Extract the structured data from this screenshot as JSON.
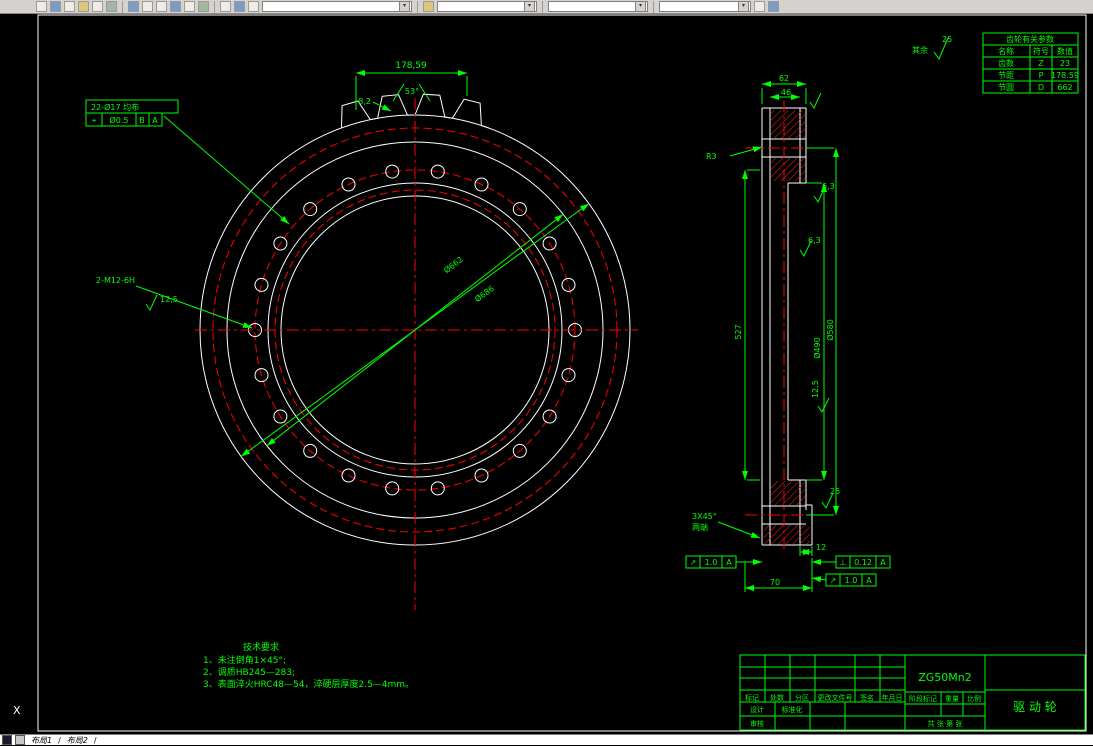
{
  "toolbar": {
    "combos": [
      "",
      "",
      "",
      ""
    ]
  },
  "tabs": {
    "items": [
      "布局1",
      "布局2"
    ],
    "sep": "/"
  },
  "ucs": {
    "x_label": "X"
  },
  "front_view": {
    "dim_width": "178,59",
    "dim_angle": "53°",
    "dim_tooth": "8,2",
    "holes_note": "22-Ø17 均布",
    "gdt_sym": "⌖",
    "gdt_tol": "Ø0.5",
    "gdt_d1": "B",
    "gdt_d2": "A",
    "thread_note": "2-M12-6H",
    "roughness": "12,5",
    "dia_inner": "Ø662",
    "dia_outer": "Ø686"
  },
  "section_view": {
    "dim_62": "62",
    "dim_46": "46",
    "r3": "R3",
    "dim_527": "527",
    "dia_490": "Ø490",
    "dia_580": "Ø580",
    "rough_63a": "6,3",
    "rough_63b": "6,3",
    "rough_125": "12,5",
    "rough_25": "25",
    "chamfer_1": "3X45°",
    "chamfer_2": "两端",
    "dim_12": "12",
    "dim_70": "70",
    "gdt1_sym": "↗",
    "gdt1_tol": "1.0",
    "gdt1_datum": "A",
    "gdt2_sym": "⊥",
    "gdt2_tol": "0.12",
    "gdt2_datum": "A",
    "gdt3_sym": "↗",
    "gdt3_tol": "1.0",
    "gdt3_datum": "A"
  },
  "general_rough": {
    "label": "其余",
    "value": "25"
  },
  "param_table": {
    "title": "齿轮有关参数",
    "headers": [
      "名称",
      "符号",
      "数值"
    ],
    "rows": [
      [
        "齿数",
        "Z",
        "23"
      ],
      [
        "节距",
        "P",
        "178.59"
      ],
      [
        "节圆",
        "D",
        "662"
      ]
    ]
  },
  "tech_req": {
    "title": "技术要求",
    "line1": "1、未注倒角1×45°;",
    "line2": "2、调质HB245—283;",
    "line3": "3、表面淬火HRC48—54，淬硬层厚度2.5—4mm。"
  },
  "title_block": {
    "material": "ZG50Mn2",
    "part_name": "驱 动 轮",
    "r1": "标记",
    "r2": "处数",
    "r3": "分区",
    "r4": "更改文件号",
    "r5": "签名",
    "r6": "年月日",
    "l1": "设计",
    "l2": "审核",
    "l3": "标准化",
    "m1": "阶段标记",
    "m2": "重量",
    "m3": "比例",
    "sheet": "共 张  第 张"
  }
}
